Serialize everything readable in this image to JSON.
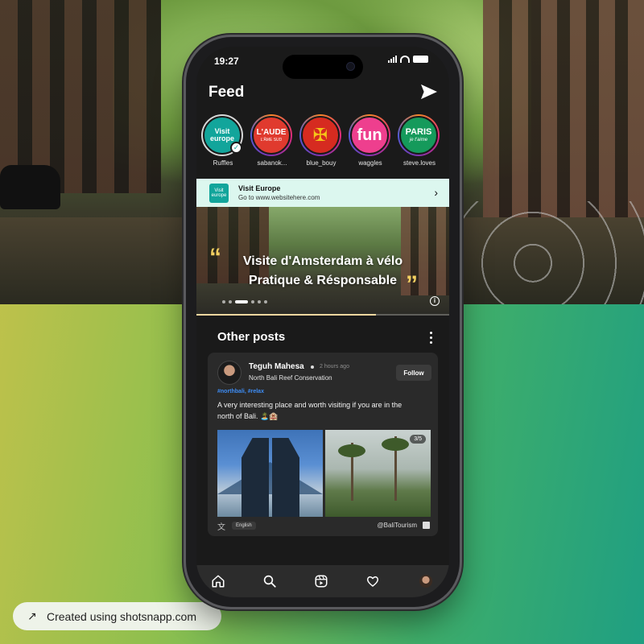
{
  "status_bar": {
    "time": "19:27"
  },
  "header": {
    "title": "Feed"
  },
  "stories": [
    {
      "name": "Ruffles",
      "label": "Visit europe",
      "bg": "#12a59b",
      "color": "#ffffff",
      "seen": true,
      "verified": true
    },
    {
      "name": "sabanok...",
      "label": "L'AUDE",
      "sub": "L'ÂME SUD",
      "bg": "#e03a2e",
      "color": "#ffffff",
      "seen": false
    },
    {
      "name": "blue_bouy",
      "label": "✠",
      "bg": "#d62b20",
      "color": "#f5c518",
      "seen": false
    },
    {
      "name": "waggles",
      "label": "fun",
      "bg": "#ee3f8e",
      "color": "#ffffff",
      "seen": false
    },
    {
      "name": "steve.loves",
      "label": "PARIS",
      "sub": "je t'aime",
      "bg": "#159a5b",
      "color": "#ffffff",
      "seen": false
    }
  ],
  "sponsor": {
    "logo_text": "Visit europe",
    "title": "Visit Europe",
    "url": "Go to www.websitehere.com"
  },
  "hero": {
    "line1": "Visite d'Amsterdam à vélo",
    "line2": "Pratique & Résponsable",
    "active_slide": 3,
    "slide_count": 6,
    "progress_fraction": 0.71
  },
  "section": {
    "title": "Other posts"
  },
  "post": {
    "username": "Teguh Mahesa",
    "time": "2 hours ago",
    "location": "North Bali Reef Conservation",
    "follow_label": "Follow",
    "tags": "#northbali, #relax",
    "body": "A very interesting place and worth visiting if you are in the north of Bali. 🏝️🏨",
    "image_count": "3/5",
    "language": "English",
    "handle": "@BaliTourism"
  },
  "badge": {
    "text": "Created using shotsnapp.com"
  },
  "colors": {
    "accent": "#12a59b",
    "tag": "#3e8ef7",
    "sponsor_bg": "#dcf7ef",
    "quote": "#f3d061"
  }
}
